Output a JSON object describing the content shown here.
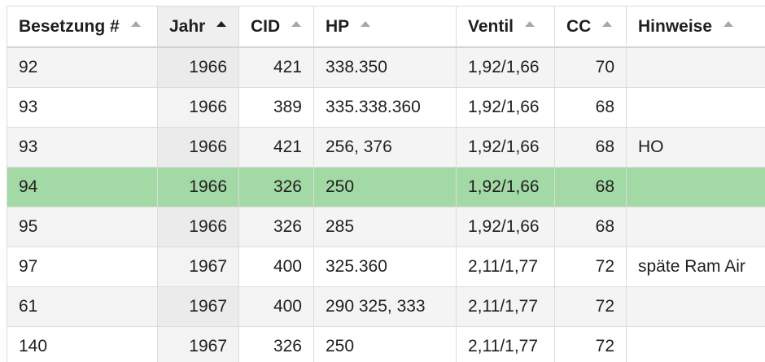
{
  "table": {
    "columns": [
      {
        "label": "Besetzung #",
        "sorted": false
      },
      {
        "label": "Jahr",
        "sorted": true
      },
      {
        "label": "CID",
        "sorted": false
      },
      {
        "label": "HP",
        "sorted": false
      },
      {
        "label": "Ventil",
        "sorted": false
      },
      {
        "label": "CC",
        "sorted": false
      },
      {
        "label": "Hinweise",
        "sorted": false
      }
    ],
    "rows": [
      [
        "92",
        "1966",
        "421",
        "338.350",
        "1,92/1,66",
        "70",
        ""
      ],
      [
        "93",
        "1966",
        "389",
        "335.338.360",
        "1,92/1,66",
        "68",
        ""
      ],
      [
        "93",
        "1966",
        "421",
        "256, 376",
        "1,92/1,66",
        "68",
        "HO"
      ],
      [
        "94",
        "1966",
        "326",
        "250",
        "1,92/1,66",
        "68",
        ""
      ],
      [
        "95",
        "1966",
        "326",
        "285",
        "1,92/1,66",
        "68",
        ""
      ],
      [
        "97",
        "1967",
        "400",
        "325.360",
        "2,11/1,77",
        "72",
        "späte Ram Air"
      ],
      [
        "61",
        "1967",
        "400",
        "290 325, 333",
        "2,11/1,77",
        "72",
        ""
      ],
      [
        "140",
        "1967",
        "326",
        "250",
        "2,11/1,77",
        "72",
        ""
      ]
    ],
    "selected_row": 3,
    "colors": {
      "selected": "#a3d9a5",
      "sorted_column": "#efefef"
    }
  }
}
